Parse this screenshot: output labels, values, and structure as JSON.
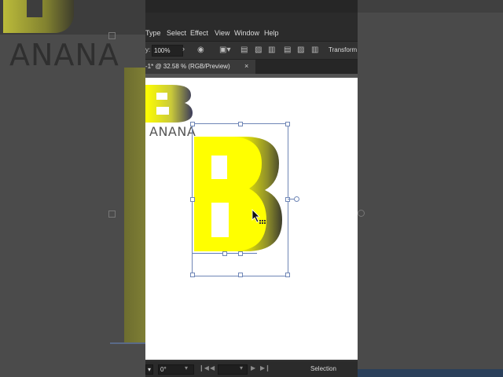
{
  "menu": {
    "items": [
      "Type",
      "Select",
      "Effect",
      "View",
      "Window",
      "Help"
    ]
  },
  "control_bar": {
    "label": "y:",
    "zoom_value": "100%",
    "transform_label": "Transform"
  },
  "document_tab": {
    "title": "-1* @ 32.58 % (RGB/Preview)",
    "close": "×"
  },
  "artwork": {
    "logo_letter": "B",
    "logo_text": "ANANA",
    "big_letter": "B",
    "background_text": "ANANA"
  },
  "status_bar": {
    "rotation": "0°",
    "tool": "Selection"
  },
  "colors": {
    "letter_fill": "#ffff00",
    "letter_shadow": "#3d3d2c",
    "selection": "#6f86b6"
  }
}
